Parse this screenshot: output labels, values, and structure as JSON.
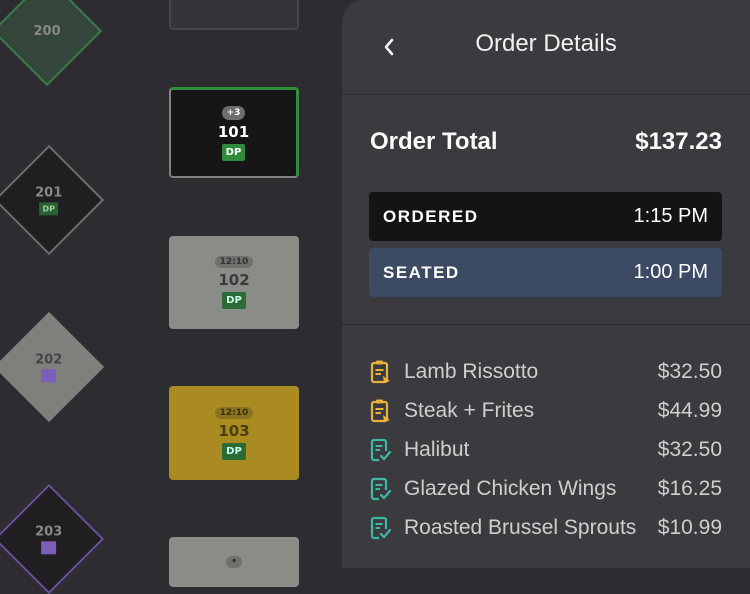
{
  "floor": {
    "tables": {
      "t101": {
        "number": "101",
        "chip": "+3",
        "badge": "DP"
      },
      "t102": {
        "number": "102",
        "chip": "12:10",
        "badge": "DP"
      },
      "t103": {
        "number": "103",
        "chip": "12:10",
        "badge": "DP"
      },
      "t200": {
        "number": "200"
      },
      "t201": {
        "number": "201",
        "badge": "DP"
      },
      "t202": {
        "number": "202"
      },
      "t203": {
        "number": "203"
      }
    }
  },
  "panel": {
    "title": "Order Details",
    "back_icon": "chevron-left-icon",
    "order_total_label": "Order Total",
    "order_total_value": "$137.23",
    "statuses": [
      {
        "label": "ORDERED",
        "time": "1:15 PM"
      },
      {
        "label": "SEATED",
        "time": "1:00 PM"
      }
    ],
    "items": [
      {
        "name": "Lamb Rissotto",
        "price": "$32.50",
        "icon": "ticket-pending-icon",
        "icon_color": "#e9b23a"
      },
      {
        "name": "Steak + Frites",
        "price": "$44.99",
        "icon": "ticket-pending-icon",
        "icon_color": "#e9b23a"
      },
      {
        "name": "Halibut",
        "price": "$32.50",
        "icon": "ticket-check-icon",
        "icon_color": "#3fb8a4"
      },
      {
        "name": "Glazed Chicken Wings",
        "price": "$16.25",
        "icon": "ticket-check-icon",
        "icon_color": "#3fb8a4"
      },
      {
        "name": "Roasted Brussel Sprouts",
        "price": "$10.99",
        "icon": "ticket-check-icon",
        "icon_color": "#3fb8a4"
      }
    ]
  },
  "colors": {
    "ordered_bg": "#141416",
    "seated_bg": "#3d4a63",
    "pending_icon": "#e9b23a",
    "done_icon": "#3fb8a4"
  }
}
